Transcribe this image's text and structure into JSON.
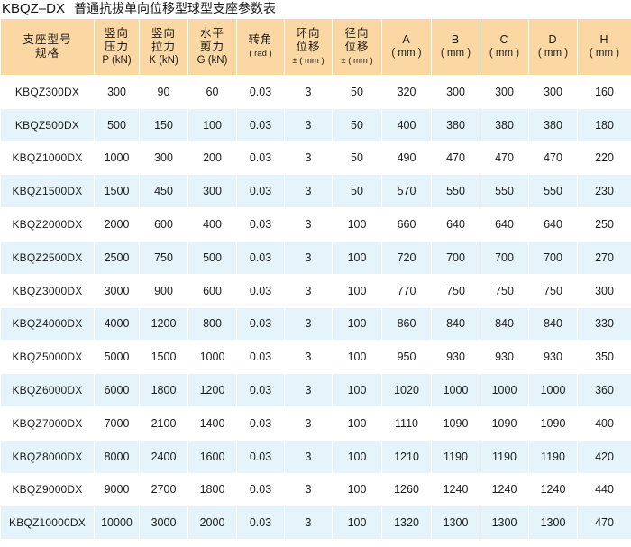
{
  "title": {
    "code": "KBQZ–DX",
    "text": "普通抗拔单向位移型球型支座参数表"
  },
  "headers": [
    {
      "main": "支座型号",
      "unit": "规格",
      "unit_small": false
    },
    {
      "main": "竖向",
      "unit": "压力",
      "unit2": "P (kN)"
    },
    {
      "main": "竖向",
      "unit": "拉力",
      "unit2": "K (kN)"
    },
    {
      "main": "水平",
      "unit": "剪力",
      "unit2": "G (kN)"
    },
    {
      "main": "转角",
      "unit2": "( rad )"
    },
    {
      "main": "环向",
      "unit": "位移",
      "unit2": "± ( mm )"
    },
    {
      "main": "径向",
      "unit": "位移",
      "unit2": "± ( mm )"
    },
    {
      "main": "A",
      "unit2": "( mm )"
    },
    {
      "main": "B",
      "unit2": "( mm )"
    },
    {
      "main": "C",
      "unit2": "( mm )"
    },
    {
      "main": "D",
      "unit2": "( mm )"
    },
    {
      "main": "H",
      "unit2": "( mm )"
    }
  ],
  "rows": [
    [
      "KBQZ300DX",
      "300",
      "90",
      "60",
      "0.03",
      "3",
      "50",
      "320",
      "300",
      "300",
      "300",
      "160"
    ],
    [
      "KBQZ500DX",
      "500",
      "150",
      "100",
      "0.03",
      "3",
      "50",
      "400",
      "380",
      "380",
      "380",
      "180"
    ],
    [
      "KBQZ1000DX",
      "1000",
      "300",
      "200",
      "0.03",
      "3",
      "50",
      "490",
      "470",
      "470",
      "470",
      "220"
    ],
    [
      "KBQZ1500DX",
      "1500",
      "450",
      "300",
      "0.03",
      "3",
      "50",
      "570",
      "550",
      "550",
      "550",
      "230"
    ],
    [
      "KBQZ2000DX",
      "2000",
      "600",
      "400",
      "0.03",
      "3",
      "100",
      "660",
      "640",
      "640",
      "640",
      "250"
    ],
    [
      "KBQZ2500DX",
      "2500",
      "750",
      "500",
      "0.03",
      "3",
      "100",
      "720",
      "700",
      "700",
      "700",
      "270"
    ],
    [
      "KBQZ3000DX",
      "3000",
      "900",
      "600",
      "0.03",
      "3",
      "100",
      "770",
      "750",
      "750",
      "750",
      "300"
    ],
    [
      "KBQZ4000DX",
      "4000",
      "1200",
      "800",
      "0.03",
      "3",
      "100",
      "860",
      "840",
      "840",
      "840",
      "330"
    ],
    [
      "KBQZ5000DX",
      "5000",
      "1500",
      "1000",
      "0.03",
      "3",
      "100",
      "950",
      "930",
      "930",
      "930",
      "350"
    ],
    [
      "KBQZ6000DX",
      "6000",
      "1800",
      "1200",
      "0.03",
      "3",
      "100",
      "1020",
      "1000",
      "1000",
      "1000",
      "360"
    ],
    [
      "KBQZ7000DX",
      "7000",
      "2100",
      "1400",
      "0.03",
      "3",
      "100",
      "1110",
      "1090",
      "1090",
      "1090",
      "400"
    ],
    [
      "KBQZ8000DX",
      "8000",
      "2400",
      "1600",
      "0.03",
      "3",
      "100",
      "1210",
      "1190",
      "1190",
      "1190",
      "420"
    ],
    [
      "KBQZ9000DX",
      "9000",
      "2700",
      "1800",
      "0.03",
      "3",
      "100",
      "1260",
      "1240",
      "1240",
      "1240",
      "440"
    ],
    [
      "KBQZ10000DX",
      "10000",
      "3000",
      "2000",
      "0.03",
      "3",
      "100",
      "1320",
      "1300",
      "1300",
      "1300",
      "470"
    ]
  ],
  "colors": {
    "header_bg": "#fbd8a3",
    "row_alt_bg": "#e5f4fb",
    "row_bg": "#ffffff"
  }
}
